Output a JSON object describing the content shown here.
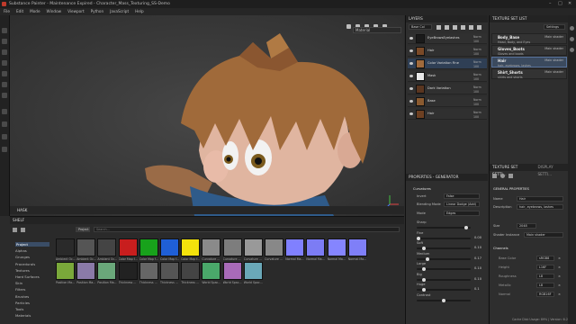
{
  "titlebar": {
    "title": "Substance Painter - Maintenance Expired - Character_Mass_Texturing_SS-Demo"
  },
  "menu": [
    "File",
    "Edit",
    "Mode",
    "Window",
    "Viewport",
    "Python",
    "JavaScript",
    "Help"
  ],
  "viewport": {
    "material_mode": "Material",
    "hw_label": "HASK"
  },
  "layers": {
    "title": "LAYERS",
    "channel_select": "Base Col",
    "rows": [
      {
        "name": "EyeBrowsEyelashes",
        "blend": "Norm",
        "opacity": "100",
        "thumb": "#1a1a1a"
      },
      {
        "name": "Hair",
        "blend": "Norm",
        "opacity": "100",
        "thumb": "#7a4a28"
      },
      {
        "name": "Color Variation Fine",
        "blend": "Norm",
        "opacity": "100",
        "thumb": "#a06a3c"
      },
      {
        "name": "Mask",
        "blend": "Norm",
        "opacity": "100",
        "thumb": "#e8e8e8"
      },
      {
        "name": "Dark Variation",
        "blend": "Norm",
        "opacity": "100",
        "thumb": "#5a3620"
      },
      {
        "name": "Base",
        "blend": "Norm",
        "opacity": "100",
        "thumb": "#8a5a30"
      },
      {
        "name": "Hair",
        "blend": "Norm",
        "opacity": "100",
        "thumb": "#6d4022"
      }
    ]
  },
  "texture_set_list": {
    "title": "TEXTURE SET LIST",
    "settings": "Settings",
    "items": [
      {
        "name": "Body_Base",
        "desc": "Head, Body, and Eyes",
        "shader": "Main shader",
        "selected": false
      },
      {
        "name": "Gloves_Boots",
        "desc": "Gloves and boots",
        "shader": "Main shader",
        "selected": false
      },
      {
        "name": "Hair",
        "desc": "hair, eyebrows, lashes",
        "shader": "Main shader",
        "selected": true
      },
      {
        "name": "Shirt_Shorts",
        "desc": "shirts and shorts",
        "shader": "Main shader",
        "selected": false
      }
    ]
  },
  "properties": {
    "title": "PROPERTIES - GENERATOR",
    "section": "Curvatures",
    "invert_label": "Invert",
    "invert_value": "False",
    "blending_label": "Blending Mode",
    "blending_value": "Linear Dodge (Add)",
    "mode_label": "Mode",
    "mode_value": "Edges",
    "sliders": [
      {
        "label": "Sharp",
        "value": "",
        "level": 0.95
      },
      {
        "label": "Fine",
        "value": "0.00",
        "level": 0.0
      },
      {
        "label": "Soft",
        "value": "0.10",
        "level": 0.1
      },
      {
        "label": "Medium",
        "value": "0.17",
        "level": 0.17
      },
      {
        "label": "Large",
        "value": "0.10",
        "level": 0.1
      },
      {
        "label": "Big",
        "value": "0.10",
        "level": 0.1
      },
      {
        "label": "Huge",
        "value": "0.1",
        "level": 0.1
      },
      {
        "label": "Contrast",
        "value": "",
        "level": 0.5
      }
    ]
  },
  "texture_set_settings": {
    "tab1": "TEXTURE SET SETTI...",
    "tab2": "DISPLAY SETTI...",
    "general_title": "GENERAL PROPERTIES",
    "name_label": "Name",
    "name_value": "Hair",
    "desc_label": "Description",
    "desc_value": "hair, eyebrows, lashes",
    "size_label": "Size",
    "size_value": "2048",
    "shader_label": "Shader Instance",
    "shader_value": "Main shader",
    "channels_title": "Channels",
    "channels": [
      {
        "label": "Base Color",
        "value": "sRGB8"
      },
      {
        "label": "Height",
        "value": "L16F"
      },
      {
        "label": "Roughness",
        "value": "L8"
      },
      {
        "label": "Metallic",
        "value": "L8"
      },
      {
        "label": "Normal",
        "value": "RGB16F"
      }
    ]
  },
  "shelf": {
    "title": "SHELF",
    "search_tag": "Project",
    "search_placeholder": "Search...",
    "categories": [
      "Project",
      "Alphas",
      "Grunges",
      "Procedurals",
      "Textures",
      "Hard Surfaces",
      "Skin",
      "Filters",
      "Brushes",
      "Particles",
      "Tools",
      "Materials"
    ],
    "selected_category": "Project",
    "thumbs_row1": [
      {
        "label": "Ambient Oc...",
        "color": "#2a2a2a"
      },
      {
        "label": "Ambient Oc...",
        "color": "#555"
      },
      {
        "label": "Ambient Oc...",
        "color": "#444"
      },
      {
        "label": "Color Map f...",
        "color": "#c81e1e"
      },
      {
        "label": "Color Map f...",
        "color": "#18a21b"
      },
      {
        "label": "Color Map f...",
        "color": "#1f5fd6"
      },
      {
        "label": "Color Map f...",
        "color": "#f3e20c"
      },
      {
        "label": "Curvature ...",
        "color": "#8a8a8a"
      },
      {
        "label": "Curvature ...",
        "color": "#7d7d7d"
      },
      {
        "label": "Curvature ...",
        "color": "#999"
      },
      {
        "label": "Curvature ...",
        "color": "#888"
      },
      {
        "label": "Normal Ma...",
        "color": "#8080ff"
      },
      {
        "label": "Normal Ma...",
        "color": "#7c7cf4"
      },
      {
        "label": "Normal Ma...",
        "color": "#8585ff"
      },
      {
        "label": "Normal Ma...",
        "color": "#7f7ff8"
      }
    ],
    "thumbs_row2": [
      {
        "label": "Position Ma...",
        "color": "#7aa83a"
      },
      {
        "label": "Position Ma...",
        "color": "#8a7aa8"
      },
      {
        "label": "Position Ma...",
        "color": "#6aa87a"
      },
      {
        "label": "Thickness ...",
        "color": "#222"
      },
      {
        "label": "Thickness ...",
        "color": "#666"
      },
      {
        "label": "Thickness ...",
        "color": "#555"
      },
      {
        "label": "Thickness ...",
        "color": "#444"
      },
      {
        "label": "World Spac...",
        "color": "#4aa86a"
      },
      {
        "label": "World Spac...",
        "color": "#a86ab8"
      },
      {
        "label": "World Spac...",
        "color": "#6aa8b8"
      }
    ]
  },
  "status": {
    "text": "Cache Disk Usage:  89% | Version: 6.2"
  }
}
